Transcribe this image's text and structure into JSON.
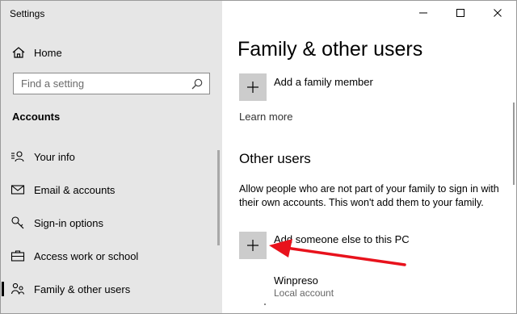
{
  "window": {
    "title": "Settings"
  },
  "sidebar": {
    "home_label": "Home",
    "search_placeholder": "Find a setting",
    "section_title": "Accounts",
    "items": [
      {
        "label": "Your info",
        "icon": "user-info-icon"
      },
      {
        "label": "Email & accounts",
        "icon": "email-icon"
      },
      {
        "label": "Sign-in options",
        "icon": "key-icon"
      },
      {
        "label": "Access work or school",
        "icon": "briefcase-icon"
      },
      {
        "label": "Family & other users",
        "icon": "family-icon",
        "selected": true
      }
    ]
  },
  "main": {
    "title": "Family & other users",
    "add_family_label": "Add a family member",
    "learn_more": "Learn more",
    "other_users_heading": "Other users",
    "other_users_desc": "Allow people who are not part of your family to sign in with their own accounts. This won't add them to your family.",
    "add_someone_label": "Add someone else to this PC",
    "users": [
      {
        "name": "Winpreso",
        "type": "Local account"
      }
    ]
  },
  "colors": {
    "sidebar_bg": "#e6e6e6",
    "tile_bg": "#cccccc",
    "annotation_arrow": "#e8121c"
  }
}
